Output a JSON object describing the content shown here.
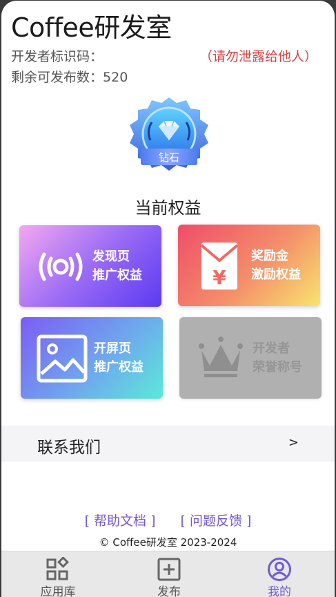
{
  "header": {
    "title": "Coffee研发室",
    "dev_id_label": "开发者标识码：",
    "dev_id_warning": "（请勿泄露给他人）",
    "remaining_label": "剩余可发布数：",
    "remaining_count": "520"
  },
  "badge": {
    "label": "钻石"
  },
  "benefits": {
    "title": "当前权益",
    "cards": [
      {
        "line1": "发现页",
        "line2": "推广权益"
      },
      {
        "line1": "奖励金",
        "line2": "激励权益"
      },
      {
        "line1": "开屏页",
        "line2": "推广权益"
      },
      {
        "line1": "开发者",
        "line2": "荣誉称号"
      }
    ]
  },
  "contact": {
    "label": "联系我们",
    "arrow": ">"
  },
  "footer": {
    "help_link": "[ 帮助文档 ]",
    "feedback_link": "[ 问题反馈 ]",
    "copyright": "© Coffee研发室 2023-2024"
  },
  "tabbar": {
    "tabs": [
      {
        "label": "应用库",
        "icon": "apps-icon"
      },
      {
        "label": "发布",
        "icon": "add-square-icon"
      },
      {
        "label": "我的",
        "icon": "user-circle-icon"
      }
    ],
    "active_index": 2
  },
  "colors": {
    "accent": "#6e5bd8",
    "warning": "#d04545",
    "tabbar_bg": "#e8e8e8"
  }
}
